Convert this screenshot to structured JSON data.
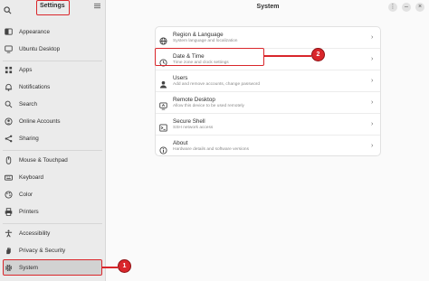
{
  "sidebar": {
    "title": "Settings",
    "menu_icon": "hamburger-menu-icon",
    "search_icon": "search-icon",
    "items": [
      {
        "label": "Appearance",
        "icon": "appearance-icon"
      },
      {
        "label": "Ubuntu Desktop",
        "icon": "ubuntu-desktop-icon"
      },
      {
        "label": "Apps",
        "icon": "apps-grid-icon"
      },
      {
        "label": "Notifications",
        "icon": "bell-icon"
      },
      {
        "label": "Search",
        "icon": "search-icon"
      },
      {
        "label": "Online Accounts",
        "icon": "online-accounts-icon"
      },
      {
        "label": "Sharing",
        "icon": "share-icon"
      },
      {
        "label": "Mouse & Touchpad",
        "icon": "mouse-icon"
      },
      {
        "label": "Keyboard",
        "icon": "keyboard-icon"
      },
      {
        "label": "Color",
        "icon": "color-palette-icon"
      },
      {
        "label": "Printers",
        "icon": "printer-icon"
      },
      {
        "label": "Accessibility",
        "icon": "accessibility-icon"
      },
      {
        "label": "Privacy & Security",
        "icon": "hand-privacy-icon"
      },
      {
        "label": "System",
        "icon": "gear-icon"
      }
    ]
  },
  "main": {
    "title": "System",
    "window_buttons": [
      "⋮",
      "–",
      "×"
    ],
    "rows": [
      {
        "title": "Region & Language",
        "subtitle": "System language and localization",
        "icon": "globe-icon"
      },
      {
        "title": "Date & Time",
        "subtitle": "Time zone and clock settings",
        "icon": "clock-icon"
      },
      {
        "title": "Users",
        "subtitle": "Add and remove accounts, change password",
        "icon": "users-icon"
      },
      {
        "title": "Remote Desktop",
        "subtitle": "Allow this device to be used remotely",
        "icon": "remote-desktop-icon"
      },
      {
        "title": "Secure Shell",
        "subtitle": "SSH network access",
        "icon": "terminal-icon"
      },
      {
        "title": "About",
        "subtitle": "Hardware details and software versions",
        "icon": "info-icon"
      }
    ]
  },
  "annotations": {
    "badge_1": "1",
    "badge_2": "2",
    "color": "#d9262b"
  }
}
